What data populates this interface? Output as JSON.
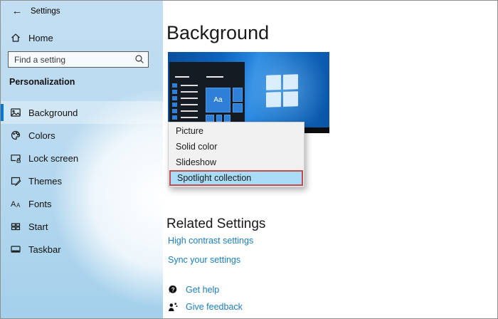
{
  "window": {
    "title": "Settings",
    "controls": [
      {
        "name": "minimize"
      },
      {
        "name": "maximize"
      },
      {
        "name": "close"
      }
    ]
  },
  "sidebar": {
    "home_label": "Home",
    "search_placeholder": "Find a setting",
    "section_label": "Personalization",
    "items": [
      {
        "label": "Background",
        "icon": "image-icon",
        "selected": true
      },
      {
        "label": "Colors",
        "icon": "palette-icon",
        "selected": false
      },
      {
        "label": "Lock screen",
        "icon": "lock-screen-icon",
        "selected": false
      },
      {
        "label": "Themes",
        "icon": "themes-icon",
        "selected": false
      },
      {
        "label": "Fonts",
        "icon": "fonts-icon",
        "selected": false
      },
      {
        "label": "Start",
        "icon": "start-grid-icon",
        "selected": false
      },
      {
        "label": "Taskbar",
        "icon": "taskbar-icon",
        "selected": false
      }
    ]
  },
  "main": {
    "title": "Background",
    "preview": {
      "tile_label": "Aa"
    },
    "dropdown": {
      "options": [
        "Picture",
        "Solid color",
        "Slideshow",
        "Spotlight collection"
      ],
      "highlighted_option": "Spotlight collection"
    },
    "related": {
      "heading": "Related Settings",
      "links": [
        "High contrast settings",
        "Sync your settings"
      ]
    },
    "help_links": [
      {
        "label": "Get help",
        "icon": "get-help-icon"
      },
      {
        "label": "Give feedback",
        "icon": "give-feedback-icon"
      }
    ]
  },
  "colors": {
    "accent": "#0078d7",
    "link": "#1b7dbd",
    "highlight_fill": "#a9dcf7",
    "annotation_red": "#c14a52"
  }
}
